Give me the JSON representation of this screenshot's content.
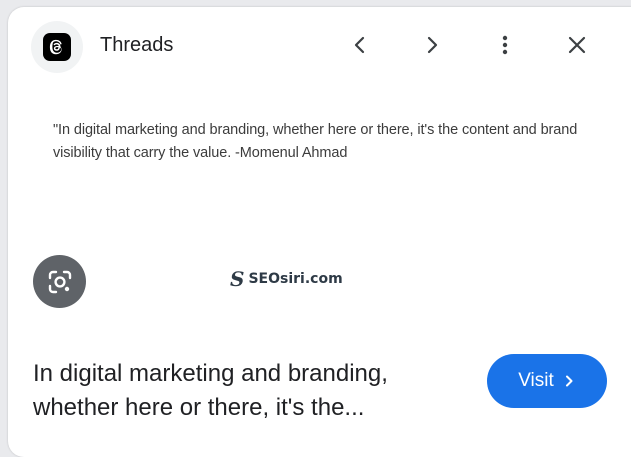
{
  "header": {
    "site_name": "Threads",
    "site_icon": "threads-logo-icon",
    "buttons": {
      "prev": "chevron-left-icon",
      "next": "chevron-right-icon",
      "more": "more-vert-icon",
      "close": "close-icon"
    }
  },
  "image": {
    "quote": "\"In digital marketing and branding, whether here or there, it's the content and brand visibility that carry the value. -Momenul Ahmad",
    "brand_mark": "S",
    "brand_text": "SEOsiri.com",
    "lens_icon": "google-lens-icon"
  },
  "footer": {
    "title": "In digital marketing and branding, whether here or there, it's the...",
    "visit_label": "Visit"
  },
  "colors": {
    "accent": "#1a73e8",
    "lens_bg": "#5f6368",
    "text": "#202124"
  }
}
